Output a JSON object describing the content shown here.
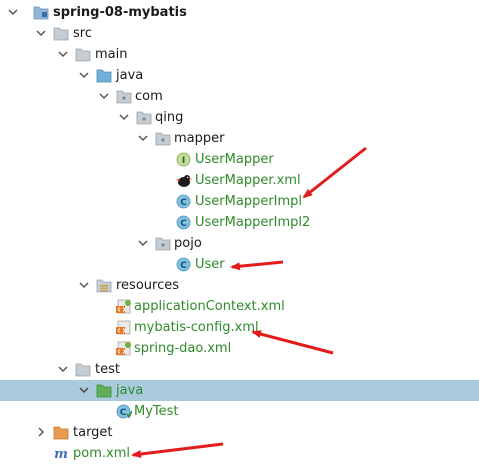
{
  "project": {
    "name": "spring-08-mybatis"
  },
  "tree": {
    "src": "src",
    "main": "main",
    "java_main": "java",
    "com": "com",
    "qing": "qing",
    "mapper": "mapper",
    "usermapper": "UserMapper",
    "usermapper_xml": "UserMapper.xml",
    "usermapperimpl": "UserMapperImpl",
    "usermapperimpl2": "UserMapperImpl2",
    "pojo": "pojo",
    "user": "User",
    "resources": "resources",
    "appcontext": "applicationContext.xml",
    "mybatis_config": "mybatis-config.xml",
    "spring_dao": "spring-dao.xml",
    "test": "test",
    "java_test": "java",
    "mytest": "MyTest",
    "target": "target",
    "pom": "pom.xml"
  },
  "icons": {
    "interface_letter": "I",
    "class_letter": "C"
  },
  "colors": {
    "selection": "#aacbdd",
    "green_text": "#2f8a2a",
    "annotation_arrow": "#e31b1b"
  }
}
